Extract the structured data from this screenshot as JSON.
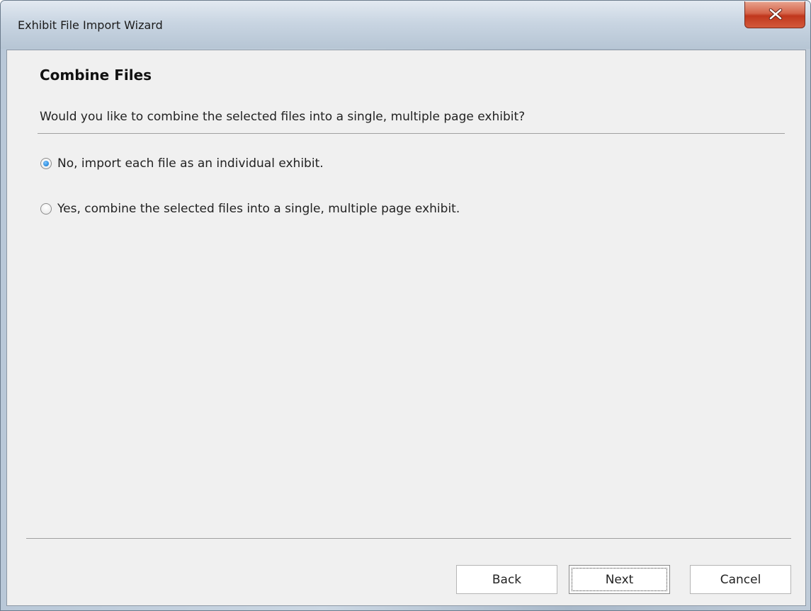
{
  "window": {
    "title": "Exhibit File Import Wizard",
    "close_icon": "close-icon"
  },
  "page": {
    "title": "Combine Files",
    "question": "Would you like to combine the selected files into a single, multiple page exhibit?"
  },
  "options": [
    {
      "label": "No, import each file as an individual exhibit.",
      "checked": true
    },
    {
      "label": "Yes, combine the selected files into a single, multiple page exhibit.",
      "checked": false
    }
  ],
  "buttons": {
    "back_label": "Back",
    "next_label": "Next",
    "cancel_label": "Cancel"
  },
  "colors": {
    "accent": "#1a7fd6",
    "close_button": "#c7462a"
  }
}
